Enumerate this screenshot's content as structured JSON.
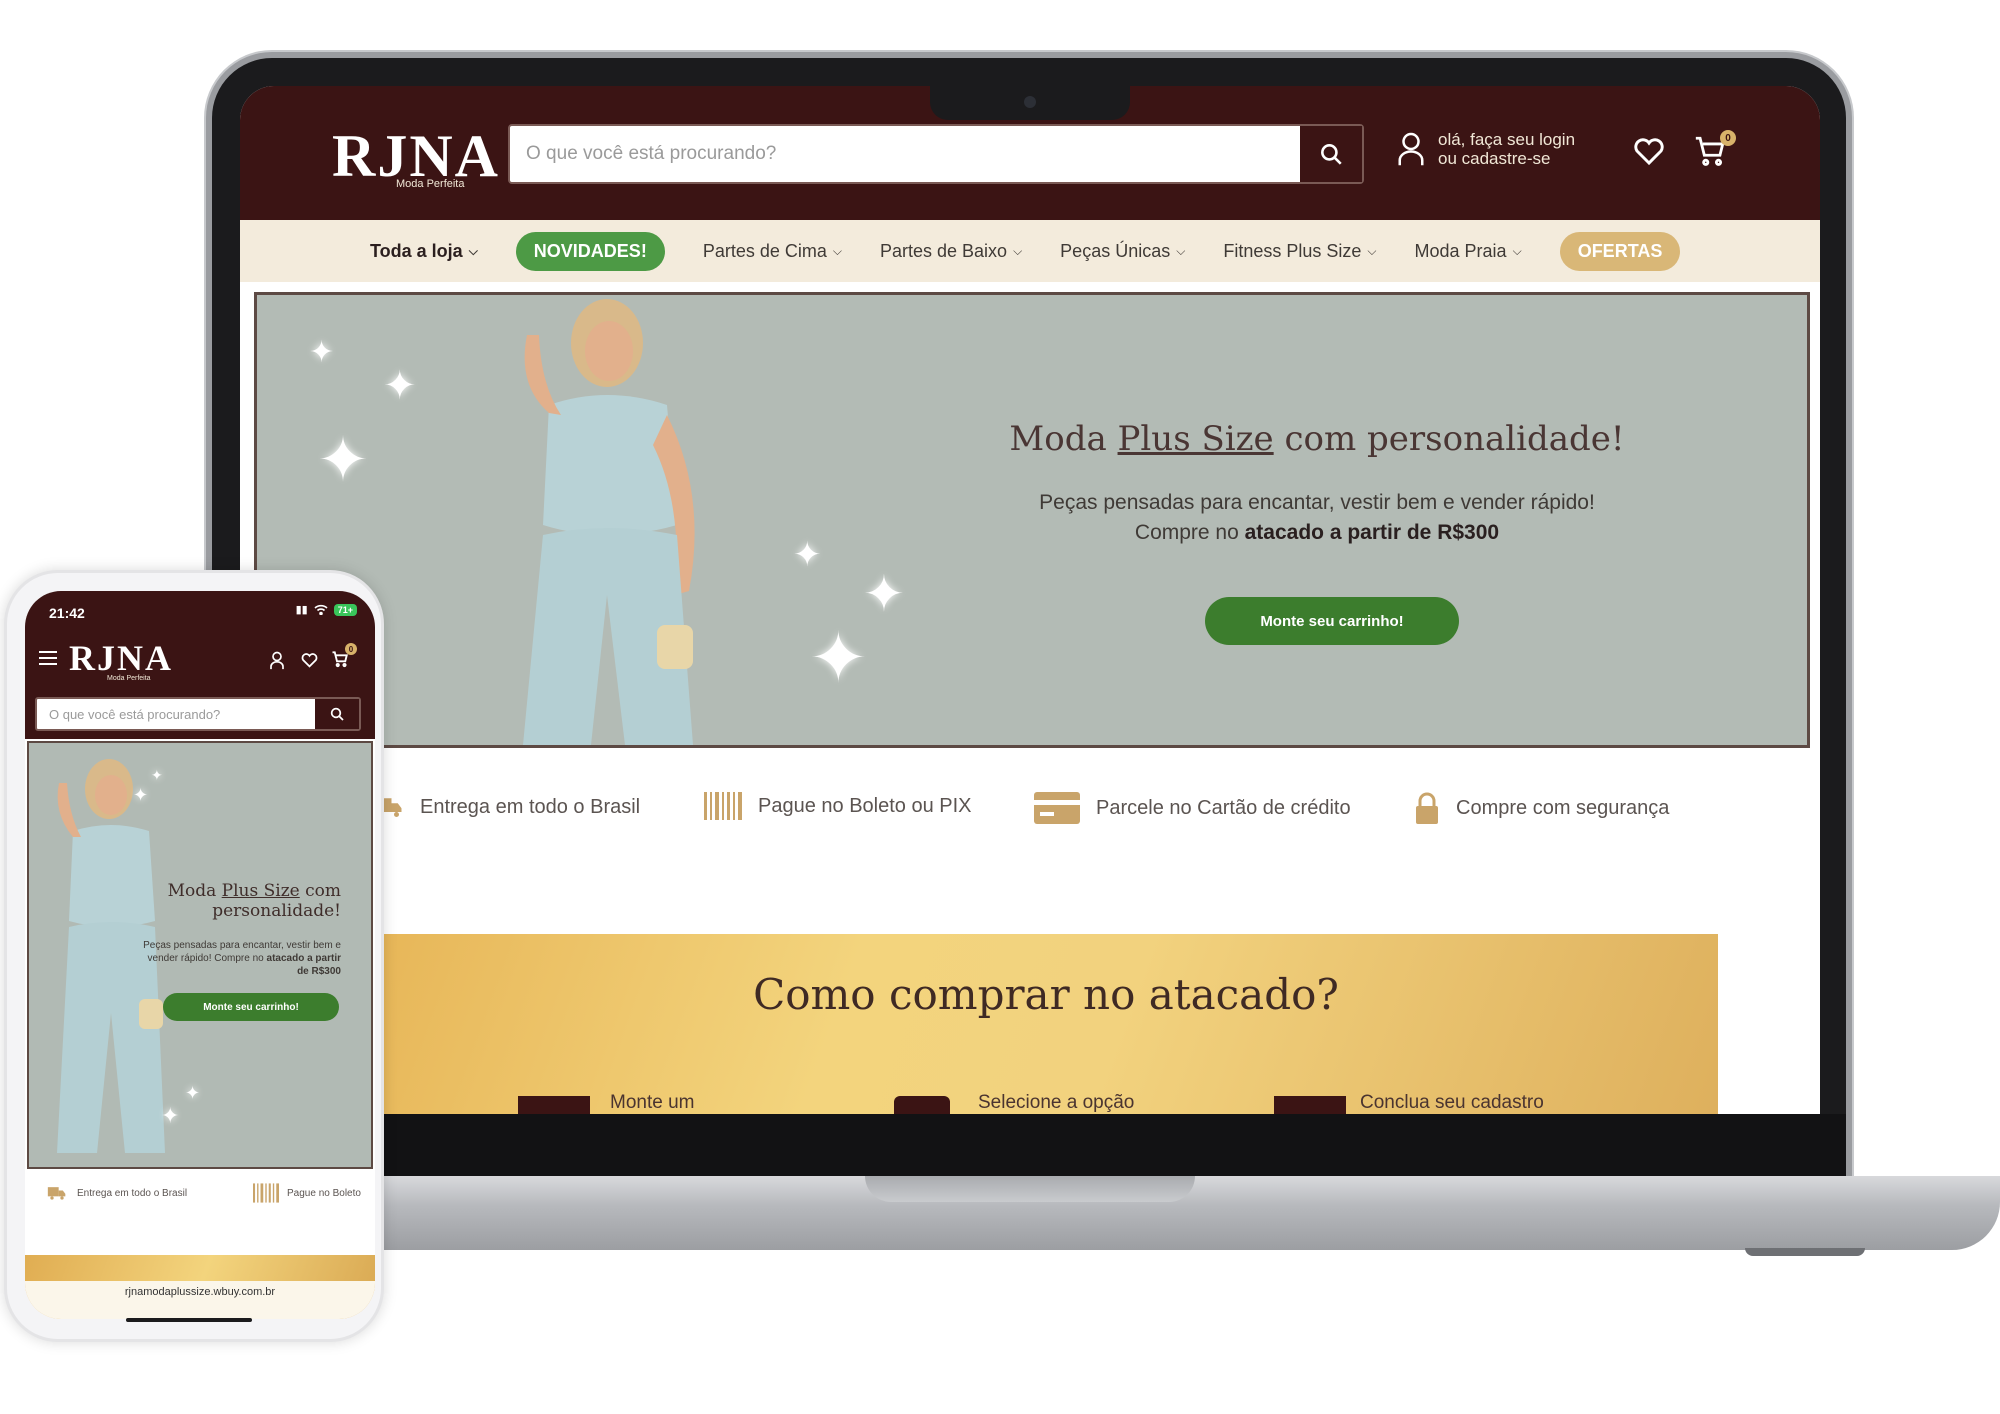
{
  "brand": {
    "logo": "RJNA",
    "logo_sub": "Moda Perfeita"
  },
  "header": {
    "search_placeholder": "O que você está procurando?",
    "login_line1": "olá, faça seu login",
    "login_line2": "ou cadastre-se",
    "cart_count": "0"
  },
  "nav": {
    "items": [
      {
        "label": "Toda a loja",
        "dropdown": true
      },
      {
        "label": "NOVIDADES!",
        "pill": "green"
      },
      {
        "label": "Partes de Cima",
        "dropdown": true
      },
      {
        "label": "Partes de Baixo",
        "dropdown": true
      },
      {
        "label": "Peças Únicas",
        "dropdown": true
      },
      {
        "label": "Fitness Plus Size",
        "dropdown": true
      },
      {
        "label": "Moda Praia",
        "dropdown": true
      },
      {
        "label": "OFERTAS",
        "pill": "gold"
      }
    ]
  },
  "hero": {
    "title_pre": "Moda ",
    "title_underlined": "Plus Size",
    "title_post": " com personalidade!",
    "sub_line1": "Peças pensadas para encantar, vestir bem e vender rápido!",
    "sub_line2_pre": "Compre no ",
    "sub_line2_bold": "atacado a partir de R$300",
    "cta": "Monte seu carrinho!"
  },
  "mobile_hero": {
    "title_line1_pre": "Moda ",
    "title_line1_underlined": "Plus Size",
    "title_line1_post": " com",
    "title_line2": "personalidade!",
    "sub_text": "Peças pensadas para encantar, vestir bem e vender rápido! Compre no",
    "sub_bold": "atacado a partir de R$300"
  },
  "benefits": [
    {
      "label": "Entrega em todo o Brasil",
      "icon": "truck-icon"
    },
    {
      "label": "Pague no Boleto ou PIX",
      "icon": "barcode-icon"
    },
    {
      "label": "Parcele no Cartão de crédito",
      "icon": "credit-card-icon"
    },
    {
      "label": "Compre com segurança",
      "icon": "lock-icon"
    }
  ],
  "mobile_benefits": [
    {
      "label": "Entrega em todo o Brasil",
      "icon": "truck-icon"
    },
    {
      "label": "Pague no Boleto",
      "icon": "barcode-icon"
    }
  ],
  "how": {
    "title": "Como comprar no atacado?",
    "steps": [
      "Monte um",
      "Selecione a opção",
      "Conclua seu cadastro"
    ]
  },
  "phone": {
    "time": "21:42",
    "battery": "71+",
    "url": "rjnamodaplussize.wbuy.com.br"
  },
  "colors": {
    "header_bg": "#3b1414",
    "nav_bg": "#f3ebdc",
    "green_pill": "#4d9a45",
    "gold_pill": "#d9b777",
    "cta_green": "#3c7d2d",
    "hero_bg": "#b3bbb5",
    "gold_banner": "#f2d27e"
  }
}
